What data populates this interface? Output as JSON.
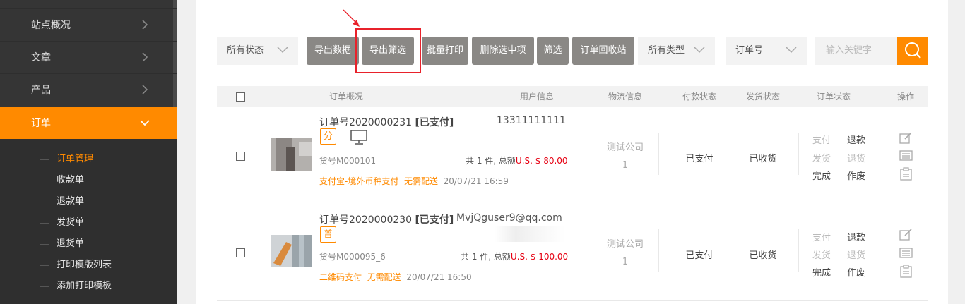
{
  "sidebar": {
    "items": [
      {
        "label": "站点概况"
      },
      {
        "label": "文章"
      },
      {
        "label": "产品"
      },
      {
        "label": "订单"
      }
    ],
    "sub_items": [
      {
        "label": "订单管理"
      },
      {
        "label": "收款单"
      },
      {
        "label": "退款单"
      },
      {
        "label": "发货单"
      },
      {
        "label": "退货单"
      },
      {
        "label": "打印模版列表"
      },
      {
        "label": "添加打印模板"
      }
    ]
  },
  "toolbar": {
    "status_select": "所有状态",
    "export_data": "导出数据",
    "export_filter": "导出筛选",
    "batch_print": "批量打印",
    "delete_selected": "删除选中项",
    "filter": "筛选",
    "recycle_bin": "订单回收站",
    "type_select": "所有类型",
    "field_select": "订单号",
    "search_placeholder": "输入关键字"
  },
  "table": {
    "headers": [
      "订单概况",
      "用户信息",
      "物流信息",
      "付款状态",
      "发货状态",
      "订单状态",
      "操作"
    ]
  },
  "orders": [
    {
      "order_no": "订单号2020000231",
      "pay_flag": "[已支付]",
      "user": "13311111111",
      "tag": "分",
      "sku": "货号M000101",
      "total_prefix": "共 1 件, 总额",
      "price": "U.S. $ 80.00",
      "pay_method": "支付宝-境外币种支付",
      "shipping": "无需配送",
      "time": "20/07/21 16:59",
      "logistics": "测试公司",
      "logistics_n": "1",
      "pay_status": "已支付",
      "ship_status": "已收货",
      "actions": [
        "支付",
        "退款",
        "发货",
        "退货",
        "完成",
        "作废"
      ]
    },
    {
      "order_no": "订单号2020000230",
      "pay_flag": "[已支付]",
      "user": "MvjQguser9@qq.com",
      "tag": "普",
      "sku": "货号M000095_6",
      "total_prefix": "共 1 件, 总额",
      "price": "U.S. $ 100.00",
      "pay_method": "二维码支付",
      "shipping": "无需配送",
      "time": "20/07/21 16:50",
      "logistics": "测试公司",
      "logistics_n": "1",
      "pay_status": "已支付",
      "ship_status": "已收货",
      "actions": [
        "支付",
        "退款",
        "发货",
        "退货",
        "完成",
        "作废"
      ]
    }
  ],
  "colors": {
    "accent": "#ff8a00",
    "sidebar": "#353535",
    "button": "#8a8885",
    "price": "#e60012",
    "highlight": "#e8222b"
  }
}
